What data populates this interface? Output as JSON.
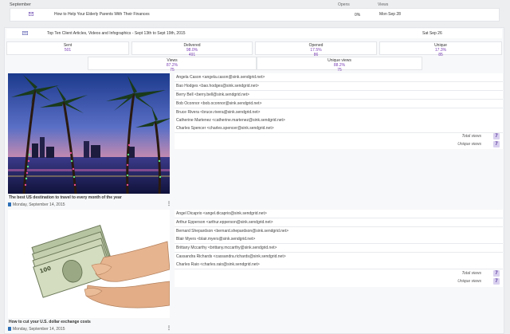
{
  "month_header": "September",
  "header_cols": {
    "opens": "Opens",
    "views": "Views"
  },
  "top_row": {
    "title": "How to Help Your Elderly Parents With Their Finances",
    "opens": "0%",
    "date": "Mon Sep 28"
  },
  "campaign": {
    "title": "Top Ten Client Articles, Videos and Infographics - Sept 13th to Sept 19th, 2015",
    "date": "Sat Sep 26"
  },
  "stats": [
    {
      "label": "Sent",
      "value": "501",
      "sub": ""
    },
    {
      "label": "Delivered",
      "value": "98.0%",
      "sub": "491"
    },
    {
      "label": "Opened",
      "value": "17.5%",
      "sub": "86"
    },
    {
      "label": "Unique",
      "value": "17.3%",
      "sub": "85"
    }
  ],
  "views_stats": [
    {
      "label": "Views",
      "value": "87.2%",
      "sub": "75"
    },
    {
      "label": "Unique views",
      "value": "88.2%",
      "sub": "75"
    }
  ],
  "articles": [
    {
      "caption": "The best US destination to travel to every month of the year",
      "date": "Monday, September 14, 2015",
      "recipients": [
        "Angela Cason <angela.cason@sink.sendgrid.net>",
        "Bao Hodges <bao.hodges@sink.sendgrid.net>",
        "Berry Bell <berry.bell@sink.sendgrid.net>",
        "Bob Oconnor <bob.oconnor@sink.sendgrid.net>",
        "Bruce Rivera <bruce.rivera@sink.sendgrid.net>",
        "Catherine Martenez <catherine.martenez@sink.sendgrid.net>",
        "Charles Spencer <charles.spencer@sink.sendgrid.net>"
      ],
      "total_views_label": "Total views",
      "unique_views_label": "Unique views",
      "total_views": "7",
      "unique_views": "7"
    },
    {
      "caption": "How to cut your U.S. dollar exchange costs",
      "date": "Monday, September 14, 2015",
      "recipients": [
        "Angel Dicaprio <angel.dicaprio@sink.sendgrid.net>",
        "Arthur Epperson <arthur.epperson@sink.sendgrid.net>",
        "Bernard Shepardson <bernard.shepardson@sink.sendgrid.net>",
        "Blair Myers <blair.myers@sink.sendgrid.net>",
        "Brittany Mccarthy <brittany.mccarthy@sink.sendgrid.net>",
        "Cassandra Richards <cassandra.richards@sink.sendgrid.net>",
        "Charles Raio <charles.raio@sink.sendgrid.net>"
      ],
      "total_views_label": "Total views",
      "unique_views_label": "Unique views",
      "total_views": "7",
      "unique_views": "7"
    }
  ],
  "icons": {
    "envelope": "envelope-icon",
    "calendar": "calendar-icon",
    "more": "more-vertical-icon",
    "newsletter": "newsletter-icon"
  }
}
